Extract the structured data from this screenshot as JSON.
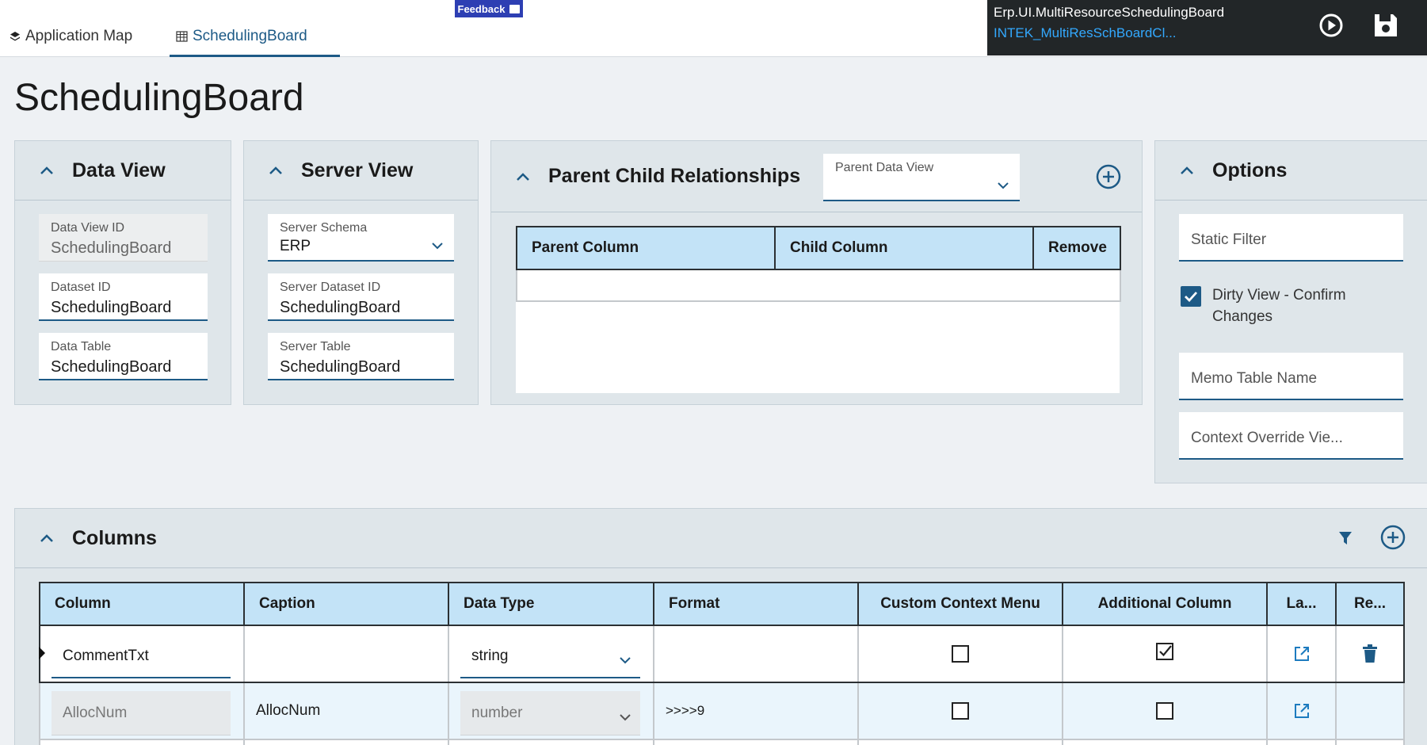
{
  "tabs": [
    {
      "label": "Application Map",
      "icon": "layers-icon"
    },
    {
      "label": "SchedulingBoard",
      "icon": "grid-icon"
    }
  ],
  "feedback_label": "Feedback",
  "info": {
    "view_name": "Erp.UI.MultiResourceSchedulingBoard",
    "layer_name": "INTEK_MultiResSchBoardCl..."
  },
  "page_title": "SchedulingBoard",
  "data_view": {
    "title": "Data View",
    "data_view_id_label": "Data View ID",
    "data_view_id_value": "SchedulingBoard",
    "dataset_id_label": "Dataset ID",
    "dataset_id_value": "SchedulingBoard",
    "data_table_label": "Data Table",
    "data_table_value": "SchedulingBoard"
  },
  "server_view": {
    "title": "Server View",
    "schema_label": "Server Schema",
    "schema_value": "ERP",
    "dataset_label": "Server Dataset ID",
    "dataset_value": "SchedulingBoard",
    "table_label": "Server Table",
    "table_value": "SchedulingBoard"
  },
  "parent_child": {
    "title": "Parent Child Relationships",
    "parent_dv_label": "Parent Data View",
    "headers": [
      "Parent Column",
      "Child Column",
      "Remove"
    ]
  },
  "options": {
    "title": "Options",
    "static_filter": "Static Filter",
    "dirty_view": "Dirty View - Confirm Changes",
    "dirty_view_checked": true,
    "memo_table": "Memo Table Name",
    "context_override": "Context Override Vie..."
  },
  "columns": {
    "title": "Columns",
    "headers": [
      "Column",
      "Caption",
      "Data Type",
      "Format",
      "Custom Context Menu",
      "Additional Column",
      "La...",
      "Re..."
    ],
    "rows": [
      {
        "column": "CommentTxt",
        "caption": "",
        "data_type": "string",
        "format": "",
        "custom_context_menu": false,
        "additional_column": true,
        "editable": true,
        "removable": true
      },
      {
        "column": "AllocNum",
        "caption": "AllocNum",
        "data_type": "number",
        "format": ">>>>9",
        "custom_context_menu": false,
        "additional_column": false,
        "editable": false,
        "removable": false
      }
    ]
  },
  "colors": {
    "accent": "#1d5a86",
    "header_blue": "#c3e3f7",
    "panel_bg": "#dfe6ea",
    "page_bg": "#eef1f4",
    "checkbox_checked": "#1d5a86"
  }
}
